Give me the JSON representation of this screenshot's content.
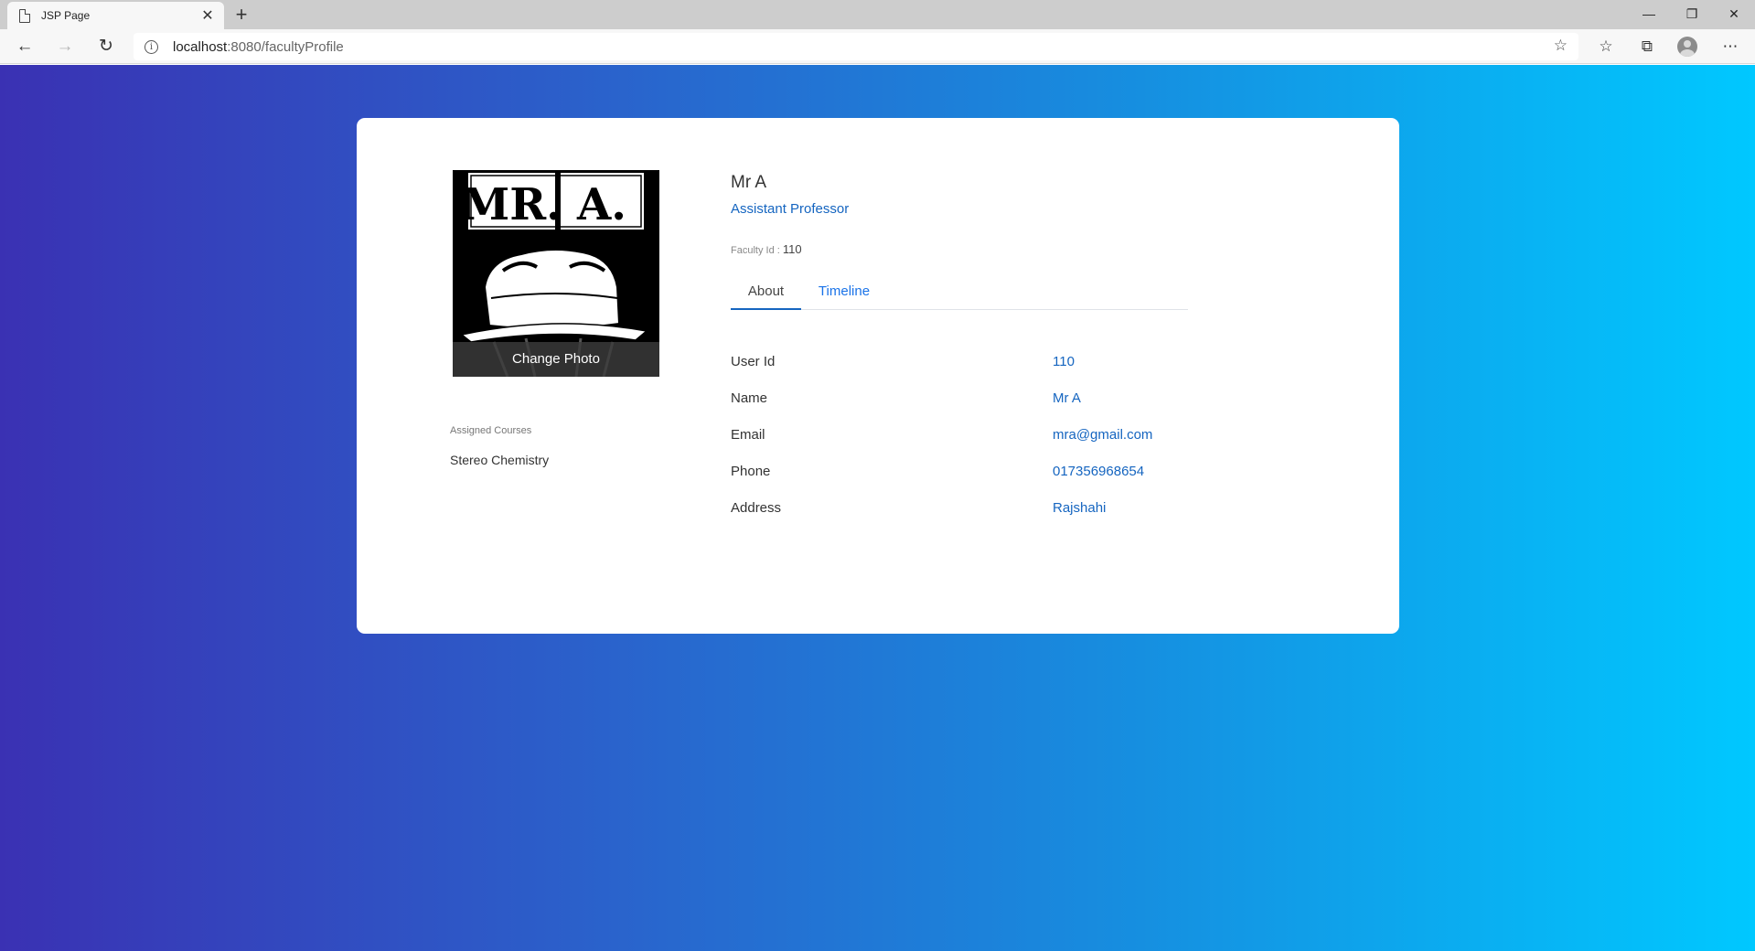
{
  "browser": {
    "tab_title": "JSP Page",
    "tab_close": "✕",
    "new_tab": "+",
    "url_host": "localhost",
    "url_path": ":8080/facultyProfile",
    "window_controls": {
      "minimize": "—",
      "restore": "❐",
      "close": "✕"
    }
  },
  "profile": {
    "photo_label": "Change Photo",
    "photo_logo_text": "MR. A.",
    "name": "Mr A",
    "title": "Assistant Professor",
    "faculty_id_label": "Faculty Id :",
    "faculty_id": "110",
    "assigned_courses_label": "Assigned Courses",
    "courses": [
      "Stereo Chemistry"
    ]
  },
  "tabs": [
    {
      "label": "About",
      "active": true
    },
    {
      "label": "Timeline",
      "active": false
    }
  ],
  "about": [
    {
      "key": "User Id",
      "value": "110"
    },
    {
      "key": "Name",
      "value": "Mr A"
    },
    {
      "key": "Email",
      "value": "mra@gmail.com"
    },
    {
      "key": "Phone",
      "value": "017356968654"
    },
    {
      "key": "Address",
      "value": "Rajshahi"
    }
  ],
  "colors": {
    "gradient_start": "#3a31b3",
    "gradient_end": "#00c8ff",
    "accent": "#1565c0",
    "card": "#ffffff"
  }
}
